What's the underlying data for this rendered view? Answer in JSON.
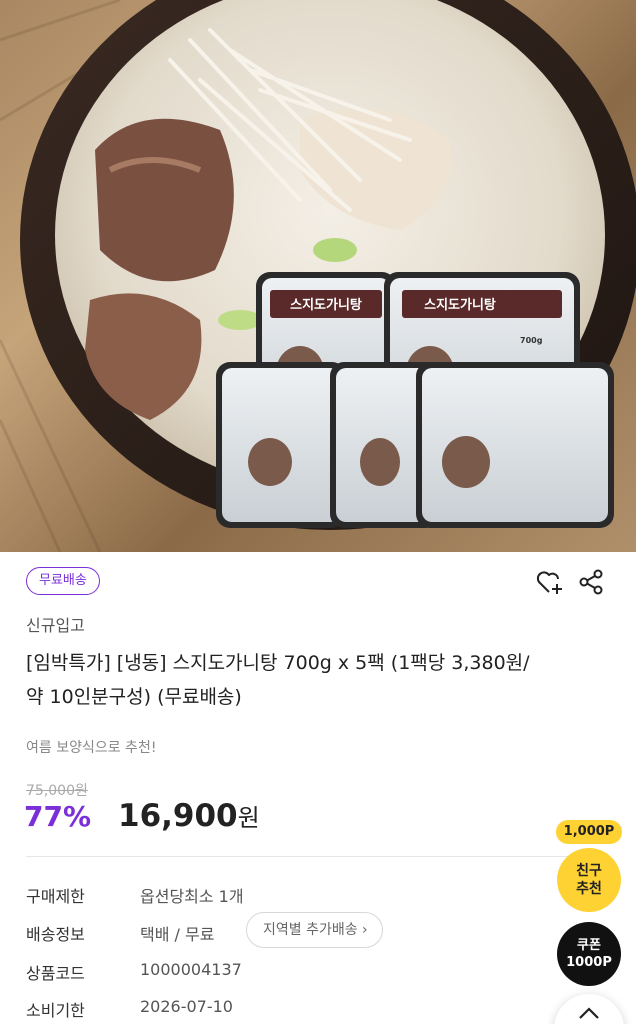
{
  "hero": {
    "pack_label": "스지도가니탕",
    "pack_weight": "700g"
  },
  "product": {
    "badge": "무료배송",
    "new_label": "신규입고",
    "title_line1": "[임박특가] [냉동] 스지도가니탕 700g x 5팩 (1팩당 3,380원/",
    "title_line2": "약 10인분구성) (무료배송)",
    "subtitle": "여름 보양식으로 추천!",
    "original_price": "75,000원",
    "discount": "77%",
    "price_number": "16,900",
    "price_unit": "원",
    "accent_color": "#7b2fd8"
  },
  "details": [
    {
      "label": "구매제한",
      "value": "옵션당최소 1개"
    },
    {
      "label": "배송정보",
      "value": "택배 / 무료",
      "button": "지역별 추가배송 ›"
    },
    {
      "label": "상품코드",
      "value": "1000004137"
    },
    {
      "label": "소비기한",
      "value": "2026-07-10"
    }
  ],
  "floating": {
    "points": "1,000P",
    "friend_line1": "친구",
    "friend_line2": "추천",
    "coupon_line1": "쿠폰",
    "coupon_line2": "1000P"
  },
  "icons": {
    "wish": "heart-plus-icon",
    "share": "share-icon",
    "scroll": "chevron-up-icon"
  }
}
